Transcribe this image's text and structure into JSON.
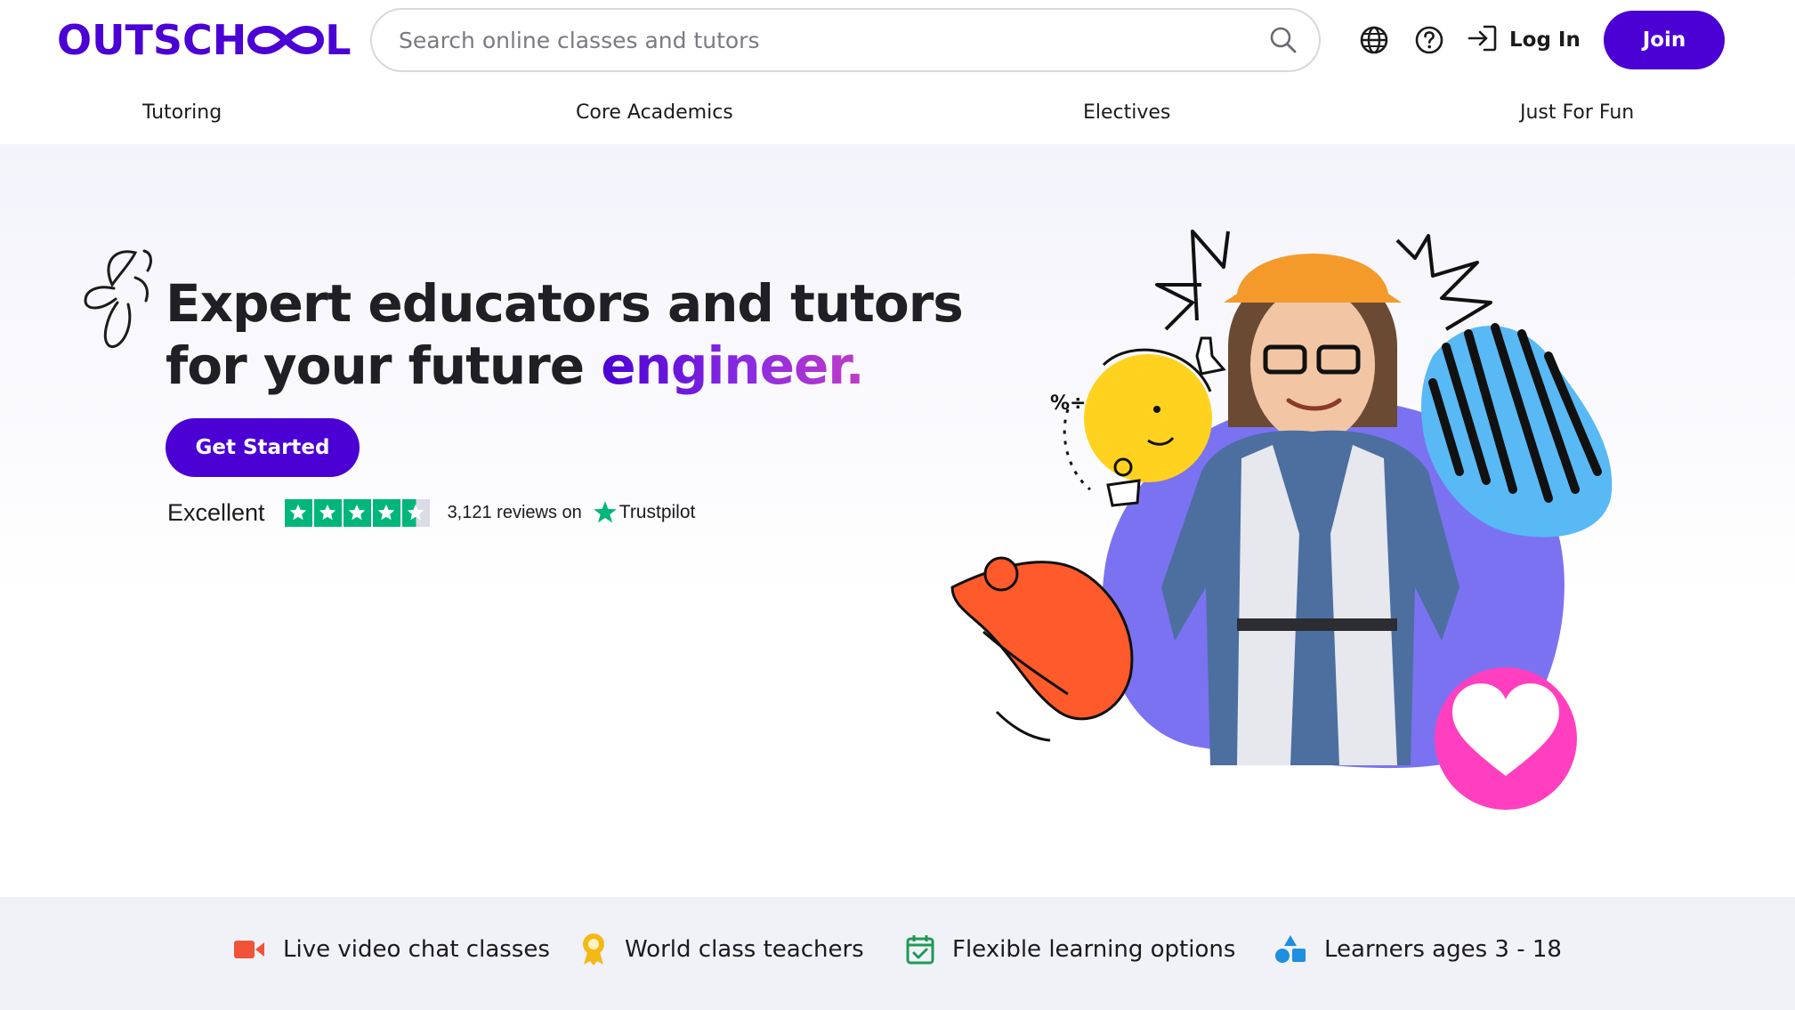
{
  "header": {
    "logo_text_left": "OUTSCH",
    "logo_text_right": "L",
    "search_placeholder": "Search online classes and tutors",
    "login_label": "Log In",
    "join_label": "Join",
    "icons": [
      "globe-icon",
      "help-icon",
      "login-arrow-icon",
      "search-icon"
    ]
  },
  "nav": {
    "items": [
      "Tutoring",
      "Core Academics",
      "Electives",
      "Just For Fun"
    ]
  },
  "hero": {
    "headline_line1": "Expert educators and tutors",
    "headline_line2_prefix": "for your future ",
    "headline_accent": "engineer.",
    "cta_label": "Get Started",
    "trust": {
      "rating_word": "Excellent",
      "stars": 4.5,
      "reviews_text": "3,121 reviews on",
      "brand": "Trustpilot"
    }
  },
  "features": [
    {
      "icon": "video-camera-icon",
      "label": "Live video chat classes"
    },
    {
      "icon": "award-ribbon-icon",
      "label": "World class teachers"
    },
    {
      "icon": "calendar-check-icon",
      "label": "Flexible learning options"
    },
    {
      "icon": "shapes-icon",
      "label": "Learners ages 3 - 18"
    }
  ],
  "colors": {
    "brand": "#4b01d4",
    "accent_pink": "#ff3fbf",
    "trust_green": "#00b67a",
    "blob_purple": "#7b72f2",
    "blob_blue": "#58b9f5",
    "doodle_yellow": "#ffd21f",
    "doodle_orange": "#ff5a2b"
  }
}
